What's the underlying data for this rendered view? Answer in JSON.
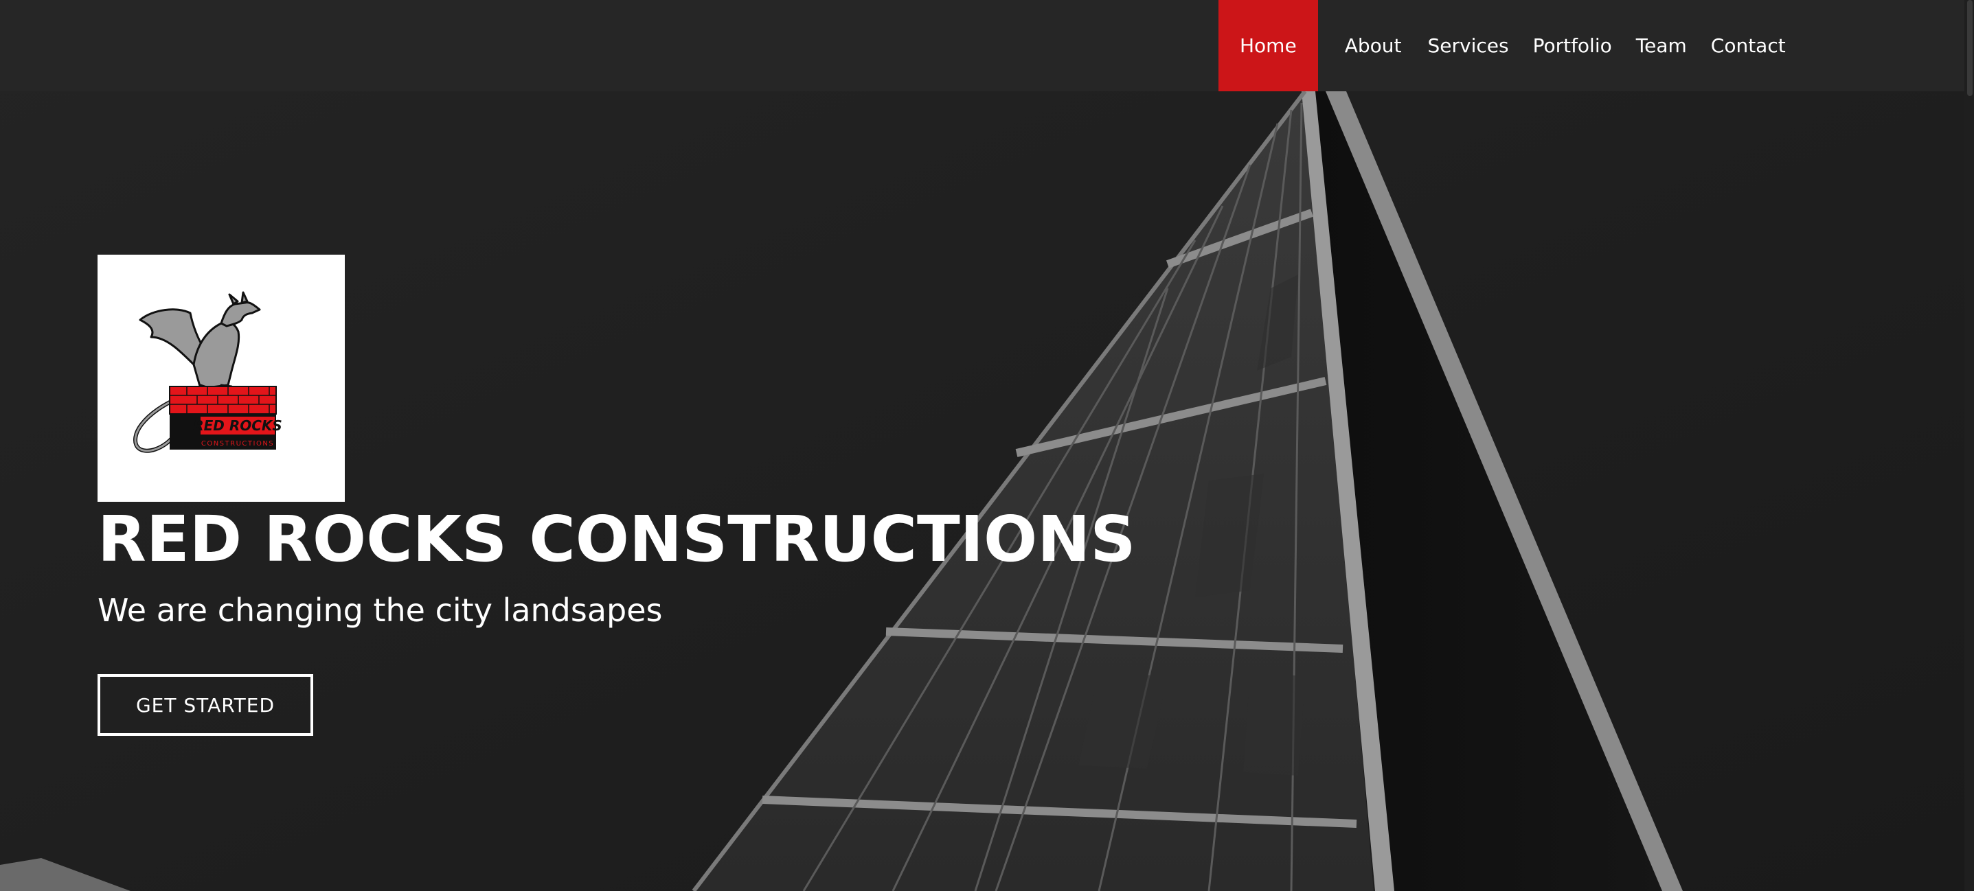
{
  "nav": {
    "items": [
      {
        "label": "Home",
        "active": true
      },
      {
        "label": "About",
        "active": false
      },
      {
        "label": "Services",
        "active": false
      },
      {
        "label": "Portfolio",
        "active": false
      },
      {
        "label": "Team",
        "active": false
      },
      {
        "label": "Contact",
        "active": false
      }
    ]
  },
  "hero": {
    "logo": {
      "icon": "dragon-on-brick-wall-logo",
      "text_line1": "RED ROCKS",
      "text_line2": "CONSTRUCTIONS"
    },
    "title": "RED ROCKS CONSTRUCTIONS",
    "subtitle": "We are changing the city landsapes",
    "cta_label": "GET STARTED"
  },
  "colors": {
    "accent": "#cc1518",
    "navbar_bg": "#262626",
    "page_bg": "#1d1d1d",
    "text": "#ffffff"
  }
}
